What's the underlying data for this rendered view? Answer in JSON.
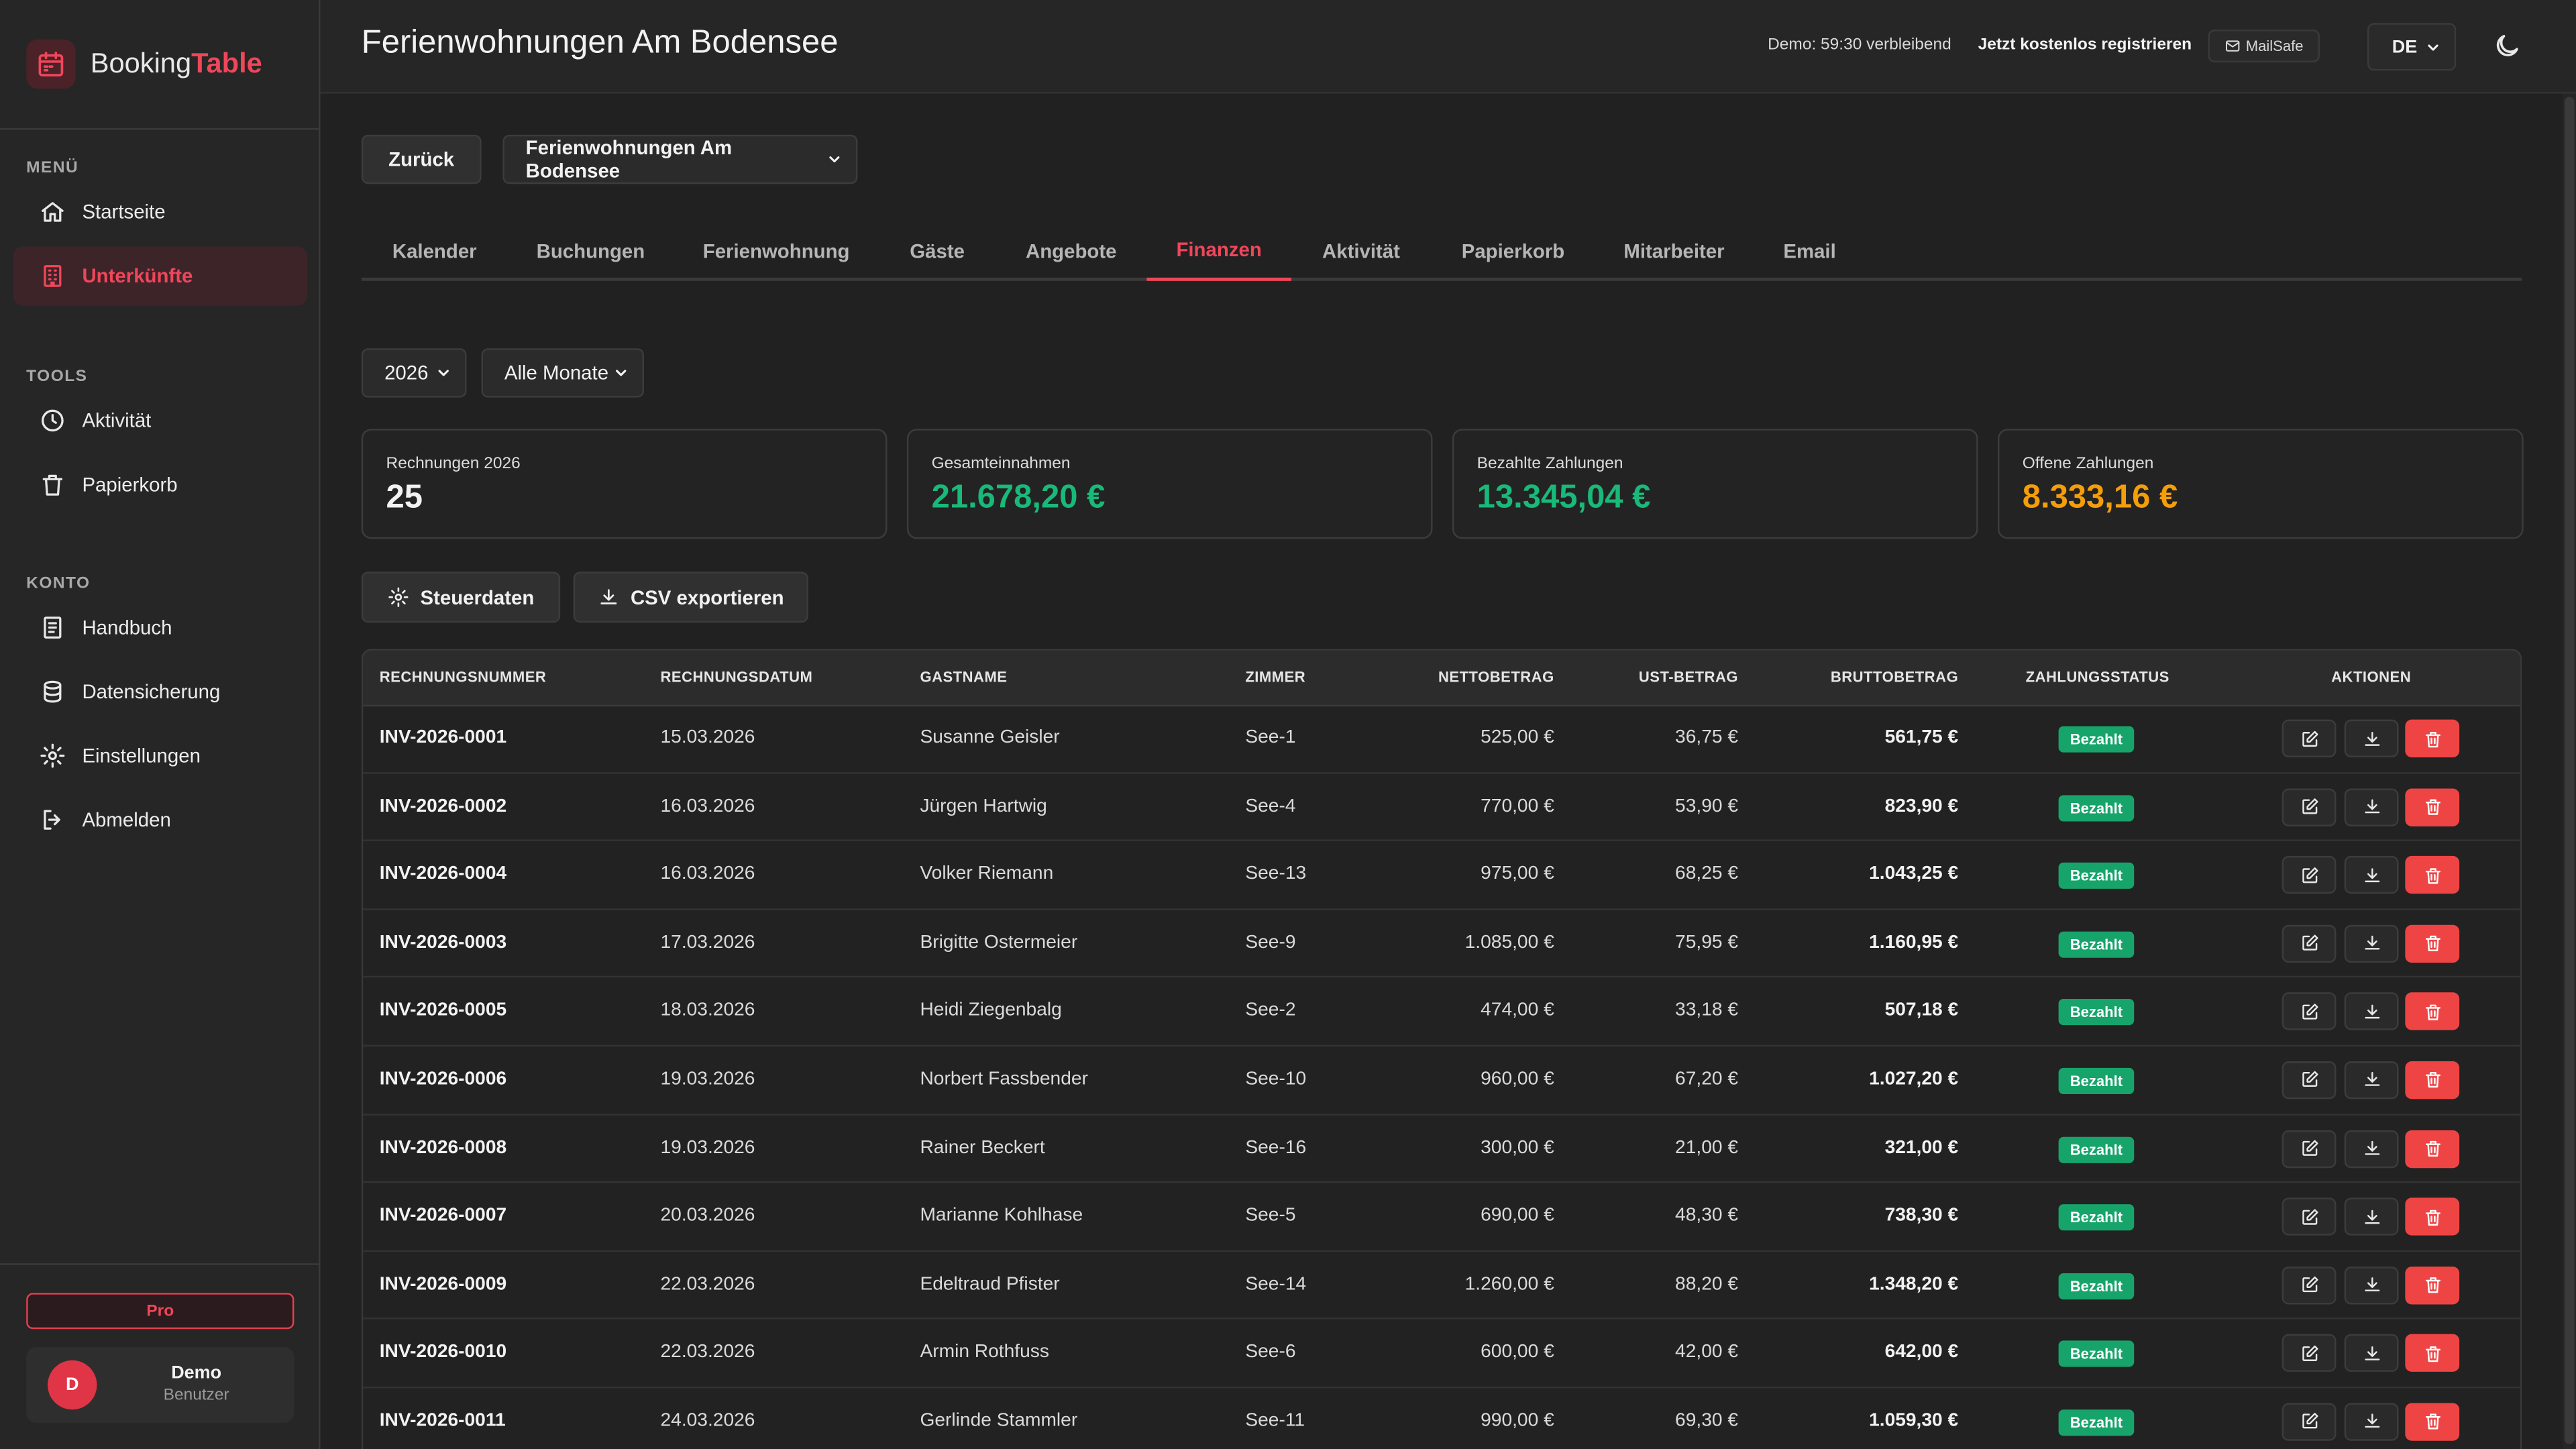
{
  "app": {
    "brand_prefix": "Booking",
    "brand_accent": "Table",
    "accent_color": "#f0465a"
  },
  "sidebar": {
    "sections": {
      "menu": "MENÜ",
      "tools": "TOOLS",
      "konto": "KONTO"
    },
    "items": [
      {
        "label": "Startseite",
        "icon": "home-icon",
        "active": false
      },
      {
        "label": "Unterkünfte",
        "icon": "building-icon",
        "active": true
      },
      {
        "label": "Aktivität",
        "icon": "clock-icon",
        "active": false
      },
      {
        "label": "Papierkorb",
        "icon": "trash-icon",
        "active": false
      },
      {
        "label": "Handbuch",
        "icon": "book-icon",
        "active": false
      },
      {
        "label": "Datensicherung",
        "icon": "database-icon",
        "active": false
      },
      {
        "label": "Einstellungen",
        "icon": "gear-icon",
        "active": false
      },
      {
        "label": "Abmelden",
        "icon": "logout-icon",
        "active": false
      }
    ],
    "plan": "Pro",
    "user": {
      "initial": "D",
      "name": "Demo",
      "role": "Benutzer"
    }
  },
  "header": {
    "title": "Ferienwohnungen Am Bodensee",
    "demo_text": "Demo: 59:30 verbleibend",
    "register_label": "Jetzt kostenlos registrieren",
    "mailsafe_label": "MailSafe",
    "language": "DE"
  },
  "toolbar": {
    "back_label": "Zurück",
    "property_select": "Ferienwohnungen Am Bodensee"
  },
  "tabs": [
    {
      "label": "Kalender",
      "active": false
    },
    {
      "label": "Buchungen",
      "active": false
    },
    {
      "label": "Ferienwohnung",
      "active": false
    },
    {
      "label": "Gäste",
      "active": false
    },
    {
      "label": "Angebote",
      "active": false
    },
    {
      "label": "Finanzen",
      "active": true
    },
    {
      "label": "Aktivität",
      "active": false
    },
    {
      "label": "Papierkorb",
      "active": false
    },
    {
      "label": "Mitarbeiter",
      "active": false
    },
    {
      "label": "Email",
      "active": false
    }
  ],
  "filters": {
    "year": "2026",
    "month": "Alle Monate"
  },
  "stats": [
    {
      "label": "Rechnungen 2026",
      "value": "25",
      "color": "#f2f2f2"
    },
    {
      "label": "Gesamteinnahmen",
      "value": "21.678,20 €",
      "color": "#19b97a"
    },
    {
      "label": "Bezahlte Zahlungen",
      "value": "13.345,04 €",
      "color": "#19b97a"
    },
    {
      "label": "Offene Zahlungen",
      "value": "8.333,16 €",
      "color": "#f59e0b"
    }
  ],
  "actions": {
    "tax_label": "Steuerdaten",
    "csv_label": "CSV exportieren"
  },
  "table": {
    "headers": {
      "invoice": "RECHNUNGSNUMMER",
      "date": "RECHNUNGSDATUM",
      "guest": "GASTNAME",
      "room": "ZIMMER",
      "net": "NETTOBETRAG",
      "vat": "UST-BETRAG",
      "gross": "BRUTTOBETRAG",
      "status": "ZAHLUNGSSTATUS",
      "actions": "AKTIONEN"
    },
    "rows": [
      {
        "invoice": "INV-2026-0001",
        "date": "15.03.2026",
        "guest": "Susanne Geisler",
        "room": "See-1",
        "net": "525,00 €",
        "vat": "36,75 €",
        "gross": "561,75 €",
        "status": "Bezahlt"
      },
      {
        "invoice": "INV-2026-0002",
        "date": "16.03.2026",
        "guest": "Jürgen Hartwig",
        "room": "See-4",
        "net": "770,00 €",
        "vat": "53,90 €",
        "gross": "823,90 €",
        "status": "Bezahlt"
      },
      {
        "invoice": "INV-2026-0004",
        "date": "16.03.2026",
        "guest": "Volker Riemann",
        "room": "See-13",
        "net": "975,00 €",
        "vat": "68,25 €",
        "gross": "1.043,25 €",
        "status": "Bezahlt"
      },
      {
        "invoice": "INV-2026-0003",
        "date": "17.03.2026",
        "guest": "Brigitte Ostermeier",
        "room": "See-9",
        "net": "1.085,00 €",
        "vat": "75,95 €",
        "gross": "1.160,95 €",
        "status": "Bezahlt"
      },
      {
        "invoice": "INV-2026-0005",
        "date": "18.03.2026",
        "guest": "Heidi Ziegenbalg",
        "room": "See-2",
        "net": "474,00 €",
        "vat": "33,18 €",
        "gross": "507,18 €",
        "status": "Bezahlt"
      },
      {
        "invoice": "INV-2026-0006",
        "date": "19.03.2026",
        "guest": "Norbert Fassbender",
        "room": "See-10",
        "net": "960,00 €",
        "vat": "67,20 €",
        "gross": "1.027,20 €",
        "status": "Bezahlt"
      },
      {
        "invoice": "INV-2026-0008",
        "date": "19.03.2026",
        "guest": "Rainer Beckert",
        "room": "See-16",
        "net": "300,00 €",
        "vat": "21,00 €",
        "gross": "321,00 €",
        "status": "Bezahlt"
      },
      {
        "invoice": "INV-2026-0007",
        "date": "20.03.2026",
        "guest": "Marianne Kohlhase",
        "room": "See-5",
        "net": "690,00 €",
        "vat": "48,30 €",
        "gross": "738,30 €",
        "status": "Bezahlt"
      },
      {
        "invoice": "INV-2026-0009",
        "date": "22.03.2026",
        "guest": "Edeltraud Pfister",
        "room": "See-14",
        "net": "1.260,00 €",
        "vat": "88,20 €",
        "gross": "1.348,20 €",
        "status": "Bezahlt"
      },
      {
        "invoice": "INV-2026-0010",
        "date": "22.03.2026",
        "guest": "Armin Rothfuss",
        "room": "See-6",
        "net": "600,00 €",
        "vat": "42,00 €",
        "gross": "642,00 €",
        "status": "Bezahlt"
      },
      {
        "invoice": "INV-2026-0011",
        "date": "24.03.2026",
        "guest": "Gerlinde Stammler",
        "room": "See-11",
        "net": "990,00 €",
        "vat": "69,30 €",
        "gross": "1.059,30 €",
        "status": "Bezahlt"
      }
    ]
  }
}
